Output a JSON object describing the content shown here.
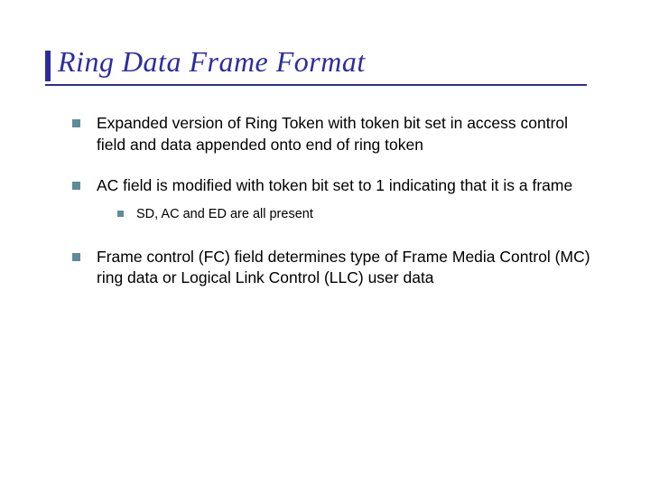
{
  "title": "Ring Data Frame Format",
  "bullets": [
    {
      "text": "Expanded version of Ring Token with token bit set in access control field and data appended onto end of ring token"
    },
    {
      "text": "AC field is modified with token bit set to 1 indicating that it is a frame",
      "sub": [
        {
          "text": "SD, AC and ED are all present"
        }
      ]
    },
    {
      "text": "Frame control (FC) field determines type of Frame Media Control (MC) ring data or Logical Link Control (LLC) user data"
    }
  ]
}
